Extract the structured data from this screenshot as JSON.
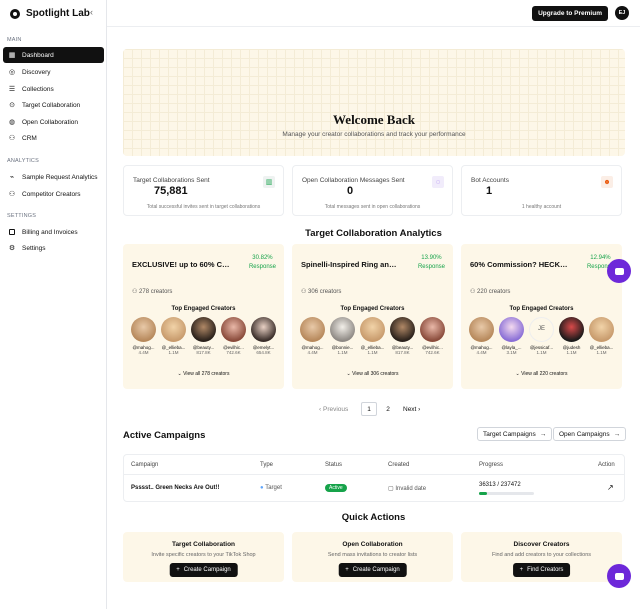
{
  "sidebar": {
    "brand": "Spotlight Lab",
    "sections": {
      "main": "MAIN",
      "analytics": "ANALYTICS",
      "settings": "SETTINGS"
    },
    "items": [
      {
        "label": "Dashboard",
        "icon": "grid-icon"
      },
      {
        "label": "Discovery",
        "icon": "compass-icon"
      },
      {
        "label": "Collections",
        "icon": "list-icon"
      },
      {
        "label": "Target Collaboration",
        "icon": "target-icon"
      },
      {
        "label": "Open Collaboration",
        "icon": "globe-icon"
      },
      {
        "label": "CRM",
        "icon": "users-icon"
      },
      {
        "label": "Sample Request Analytics",
        "icon": "chart-icon"
      },
      {
        "label": "Competitor Creators",
        "icon": "user-icon"
      },
      {
        "label": "Billing and Invoices",
        "icon": "card-icon"
      },
      {
        "label": "Settings",
        "icon": "gear-icon"
      }
    ]
  },
  "header": {
    "upgrade_label": "Upgrade to Premium",
    "avatar_initials": "EJ"
  },
  "hero": {
    "title": "Welcome Back",
    "subtitle": "Manage your creator collaborations and track your performance"
  },
  "stats": [
    {
      "label": "Target Collaborations Sent",
      "value": "75,881",
      "sub": "Total successful invites sent in target collaborations",
      "icon": "bar-chart-icon",
      "color": "#16a34a"
    },
    {
      "label": "Open Collaboration Messages Sent",
      "value": "0",
      "sub": "Total messages sent in open collaborations",
      "icon": "message-icon",
      "color": "#7c3aed"
    },
    {
      "label": "Bot Accounts",
      "value": "1",
      "sub": "1 healthy account",
      "icon": "bot-icon",
      "color": "#ea580c"
    }
  ],
  "analytics": {
    "title": "Target Collaboration Analytics",
    "top_label": "Top Engaged Creators",
    "response_label": "Response",
    "cards": [
      {
        "title": "EXCLUSIVE! up to 60% Co...",
        "pct": "30.82%",
        "creators": "278 creators",
        "view_all": "View all 278 creators",
        "people": [
          {
            "n": "@mahog...",
            "f": "4.4M"
          },
          {
            "n": "@_ellieba...",
            "f": "1.1M"
          },
          {
            "n": "@beauty...",
            "f": "817.8K"
          },
          {
            "n": "@evilhic...",
            "f": "742.6K"
          },
          {
            "n": "@emelyt...",
            "f": "654.8K"
          }
        ]
      },
      {
        "title": "Spinelli-Inspired Ring and ...",
        "pct": "13.90%",
        "creators": "306 creators",
        "view_all": "View all 306 creators",
        "people": [
          {
            "n": "@mahog...",
            "f": "4.4M"
          },
          {
            "n": "@bonnie...",
            "f": "1.1M"
          },
          {
            "n": "@_ellieba...",
            "f": "1.1M"
          },
          {
            "n": "@beauty...",
            "f": "817.8K"
          },
          {
            "n": "@evilhic...",
            "f": "742.6K"
          }
        ]
      },
      {
        "title": "60% Commission? HECK Y...",
        "pct": "12.94%",
        "creators": "220 creators",
        "view_all": "View all 220 creators",
        "people": [
          {
            "n": "@mahog...",
            "f": "4.4M"
          },
          {
            "n": "@layla_...",
            "f": "3.1M"
          },
          {
            "n": "@jessicaf...",
            "f": "1.1M"
          },
          {
            "n": "@judesh",
            "f": "1.1M"
          },
          {
            "n": "@_ellieba...",
            "f": "1.1M"
          }
        ]
      }
    ]
  },
  "pager": {
    "prev": "Previous",
    "p1": "1",
    "p2": "2",
    "next": "Next"
  },
  "campaigns": {
    "title": "Active Campaigns",
    "target_btn": "Target Campaigns",
    "open_btn": "Open Campaigns",
    "headers": {
      "campaign": "Campaign",
      "type": "Type",
      "status": "Status",
      "created": "Created",
      "progress": "Progress",
      "action": "Action"
    },
    "rows": [
      {
        "campaign": "Psssst.. Green Necks Are Out!!",
        "type": "Target",
        "status": "Active",
        "created": "Invalid date",
        "progress": "36313 / 237472",
        "fraction": 0.153
      }
    ]
  },
  "quick": {
    "title": "Quick Actions",
    "items": [
      {
        "title": "Target Collaboration",
        "sub": "Invite specific creators to your TikTok Shop",
        "btn": "Create Campaign"
      },
      {
        "title": "Open Collaboration",
        "sub": "Send mass invitations to creator lists",
        "btn": "Create Campaign"
      },
      {
        "title": "Discover Creators",
        "sub": "Find and add creators to your collections",
        "btn": "Find Creators"
      }
    ]
  },
  "colors": {
    "accent": "#111111",
    "success": "#16a34a",
    "chat": "#6d28d9",
    "card_bg": "#fdf7e8"
  }
}
